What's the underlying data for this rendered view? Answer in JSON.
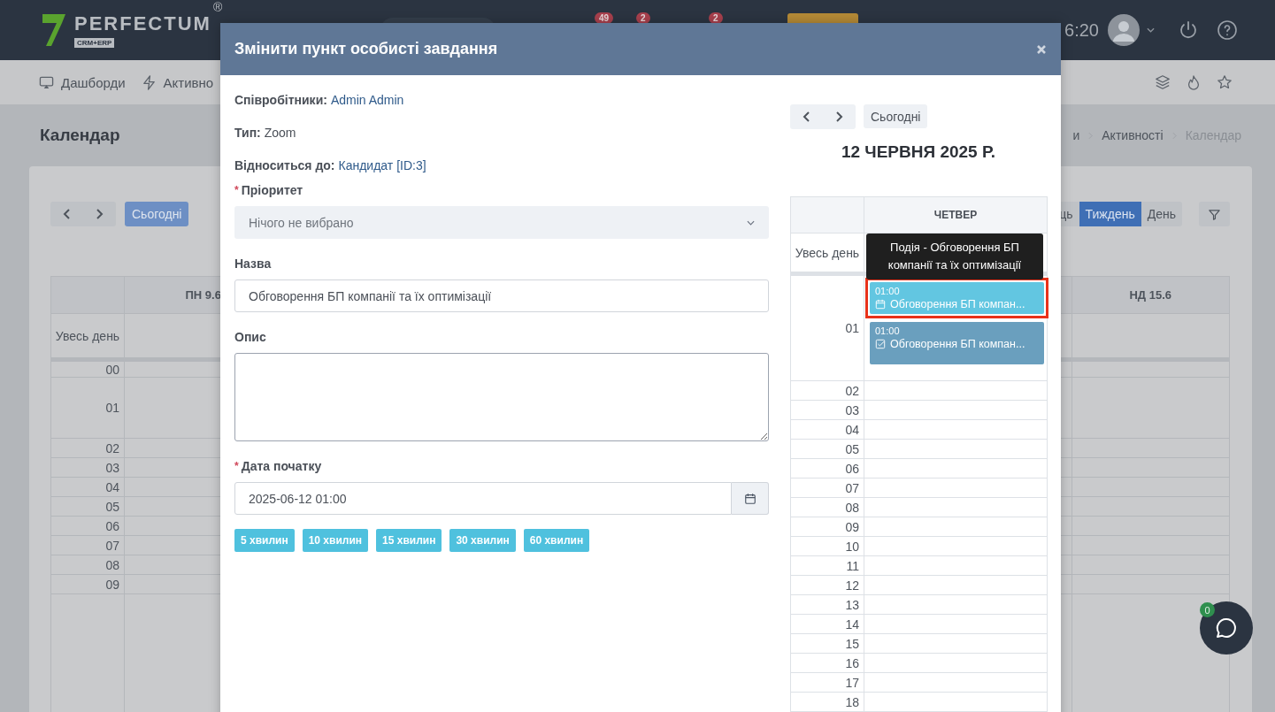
{
  "header": {
    "brand": "PERFECTUM",
    "brand_sub": "CRM+ERP",
    "brand_mark": "®",
    "badges": [
      "49",
      "2",
      "2"
    ],
    "time": "6:20"
  },
  "nav": {
    "items": [
      {
        "label": "Дашборди",
        "kind": "dashboard"
      },
      {
        "label": "Активно",
        "kind": "activity"
      }
    ]
  },
  "page": {
    "title": "Календар",
    "breadcrumbs": [
      "и",
      "Активності",
      "Календар"
    ]
  },
  "calendar": {
    "today": "Сьогодні",
    "views": [
      {
        "label": "ць",
        "selected": false
      },
      {
        "label": "Тиждень",
        "selected": true
      },
      {
        "label": "День",
        "selected": false
      }
    ],
    "columns": [
      "ПН 9.6",
      "НД 15.6"
    ],
    "all_day": "Увесь день",
    "hours": [
      "00",
      "01",
      "02",
      "03",
      "04",
      "05",
      "06",
      "07",
      "08",
      "09"
    ]
  },
  "modal": {
    "title": "Змінити пункт особисті завдання",
    "info": [
      {
        "label": "Співробітники:",
        "value": "Admin Admin",
        "link": true
      },
      {
        "label": "Тип:",
        "value": "Zoom",
        "link": false
      },
      {
        "label": "Відноситься до:",
        "value": "Кандидат [ID:3]",
        "link": true
      }
    ],
    "priority": {
      "label": "Пріоритет",
      "required_mark": "*",
      "placeholder": "Нічого не вибрано"
    },
    "name": {
      "label": "Назва",
      "value": "Обговорення БП компанії та їх оптимізації"
    },
    "description": {
      "label": "Опис"
    },
    "start": {
      "label": "Дата початку",
      "required_mark": "*",
      "value": "2025-06-12 01:00"
    },
    "quick": [
      "5 хвилин",
      "10 хвилин",
      "15 хвилин",
      "30 хвилин",
      "60 хвилин"
    ],
    "calendar": {
      "today": "Сьогодні",
      "date": "12 ЧЕРВНЯ 2025 Р.",
      "day": "ЧЕТВЕР",
      "all_day": "Увесь день",
      "event_hour": "01",
      "hours": [
        "02",
        "03",
        "04",
        "05",
        "06",
        "07",
        "08",
        "09",
        "10",
        "11",
        "12",
        "13",
        "14",
        "15",
        "16",
        "17",
        "18"
      ],
      "events": [
        {
          "time": "01:00",
          "title": "Обговорення БП компан...",
          "kind": "event",
          "highlighted": true
        },
        {
          "time": "01:00",
          "title": "Обговорення БП компан...",
          "kind": "task",
          "highlighted": false
        }
      ],
      "tooltip": "Подія - Обговорення БП компанії та їх оптимізації"
    }
  },
  "chat": {
    "count": "0"
  }
}
